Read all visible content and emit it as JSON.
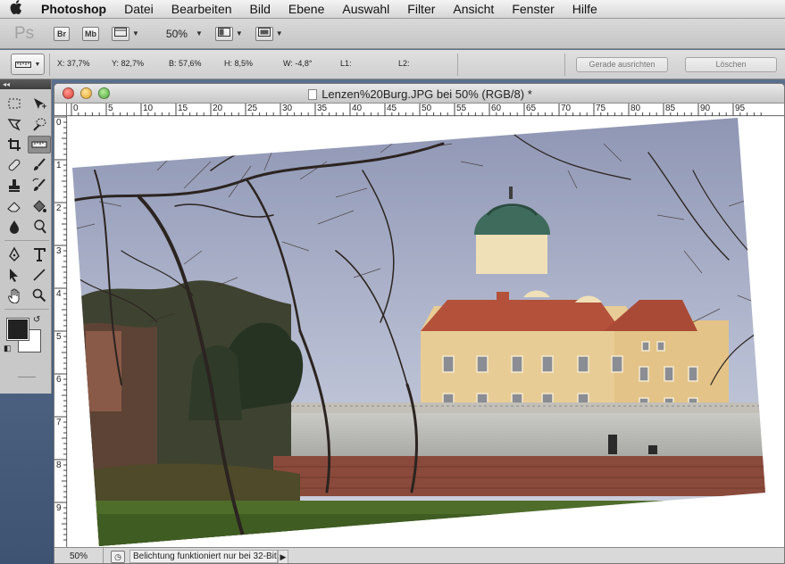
{
  "menubar": {
    "apple_icon": "apple-logo",
    "items": [
      "Photoshop",
      "Datei",
      "Bearbeiten",
      "Bild",
      "Ebene",
      "Auswahl",
      "Filter",
      "Ansicht",
      "Fenster",
      "Hilfe"
    ]
  },
  "appbar": {
    "logo": "Ps",
    "bridge": "Br",
    "minibridge": "Mb",
    "zoom": "50%"
  },
  "optionsbar": {
    "x": "X: 37,7%",
    "y": "Y: 82,7%",
    "b": "B: 57,6%",
    "h": "H: 8,5%",
    "w": "W: -4,8°",
    "l1": "L1:",
    "l2": "L2:",
    "straighten_button": "Gerade ausrichten",
    "clear_button": "Löschen"
  },
  "document": {
    "title": "Lenzen%20Burg.JPG bei 50% (RGB/8) *",
    "h_ruler": [
      "0",
      "5",
      "10",
      "15",
      "20",
      "25",
      "30",
      "35",
      "40",
      "45",
      "50",
      "55",
      "60",
      "65",
      "70",
      "75",
      "80",
      "85",
      "90",
      "95"
    ],
    "v_ruler": [
      "0",
      "1",
      "2",
      "3",
      "4",
      "5",
      "6",
      "7",
      "8",
      "9"
    ]
  },
  "statusbar": {
    "zoom": "50%",
    "message": "Belichtung funktioniert nur bei 32-Bit"
  },
  "colors": {
    "foreground": "#222222",
    "background": "#ffffff"
  }
}
